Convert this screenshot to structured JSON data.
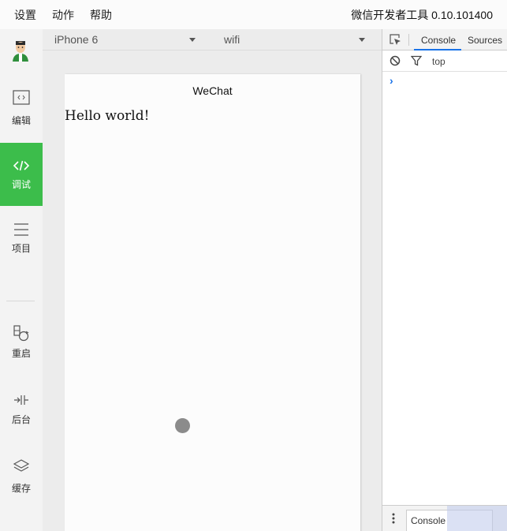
{
  "menubar": {
    "items": [
      "设置",
      "动作",
      "帮助"
    ],
    "app_title": "微信开发者工具 0.10.101400"
  },
  "sidebar": {
    "items": [
      {
        "label": "编辑",
        "icon": "code-file-icon",
        "active": false
      },
      {
        "label": "调试",
        "icon": "code-brackets-icon",
        "active": true
      },
      {
        "label": "项目",
        "icon": "hamburger-list-icon",
        "active": false
      },
      {
        "label": "重启",
        "icon": "restart-icon",
        "active": false
      },
      {
        "label": "后台",
        "icon": "background-icon",
        "active": false
      },
      {
        "label": "缓存",
        "icon": "layers-icon",
        "active": false
      }
    ],
    "active_color": "#3cbd4b"
  },
  "simulator": {
    "device": "iPhone 6",
    "network": "wifi",
    "nav_title": "WeChat",
    "content_text": "Hello world!"
  },
  "devtools": {
    "tabs": [
      "Console",
      "Sources"
    ],
    "active_tab": "Console",
    "context": "top",
    "prompt": "›",
    "drawer_tab": "Console",
    "accent_color": "#1a73e8"
  }
}
